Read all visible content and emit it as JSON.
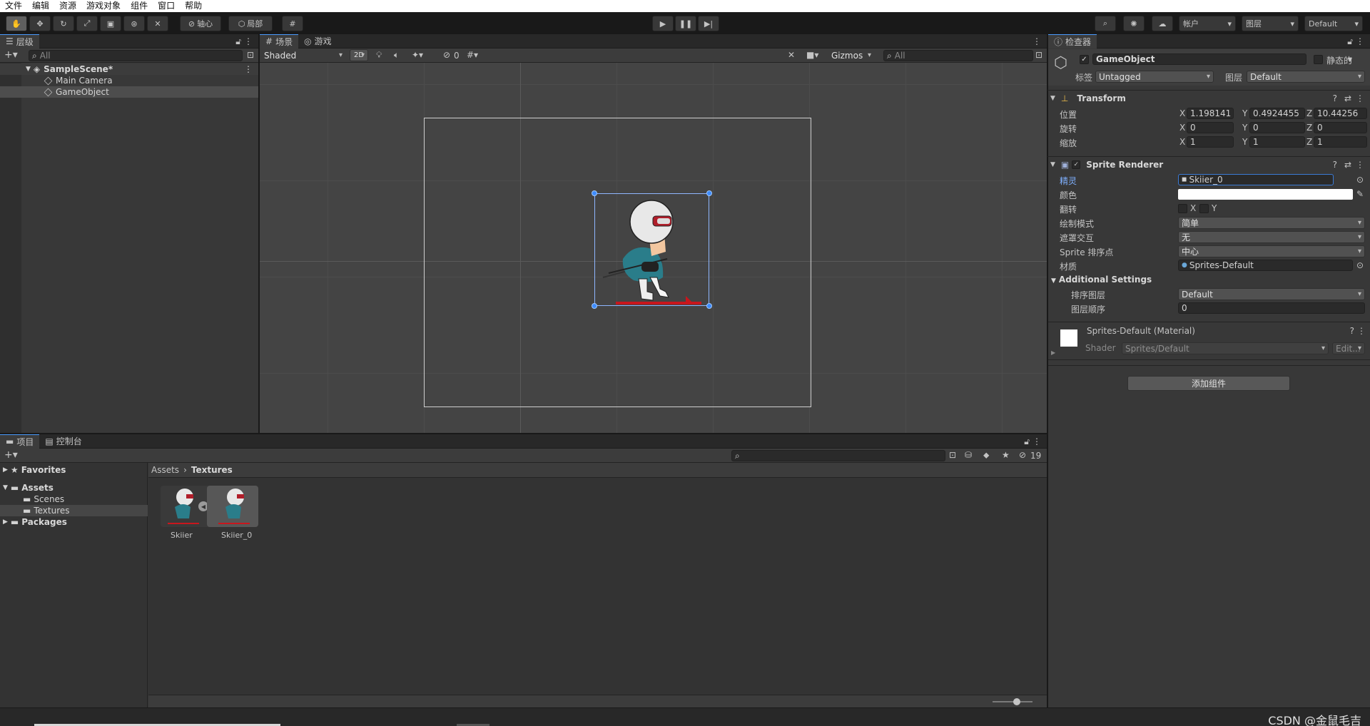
{
  "menu": [
    "文件",
    "编辑",
    "资源",
    "游戏对象",
    "组件",
    "窗口",
    "帮助"
  ],
  "toolbar": {
    "pivot": "轴心",
    "local": "局部",
    "account": "帐户",
    "layers": "图层",
    "layout": "Default"
  },
  "hierarchy": {
    "tab": "层级",
    "search_placeholder": "All",
    "scene": "SampleScene*",
    "items": [
      "Main Camera",
      "GameObject"
    ]
  },
  "scene_view": {
    "tabs": [
      "场景",
      "游戏"
    ],
    "shading": "Shaded",
    "mode2d": "2D",
    "hidden_count": "0",
    "gizmos": "Gizmos",
    "search_placeholder": "All"
  },
  "project": {
    "tabs": [
      "项目",
      "控制台"
    ],
    "hidden_count": "19",
    "tree": {
      "favorites": "Favorites",
      "assets": "Assets",
      "children": [
        "Scenes",
        "Textures"
      ],
      "packages": "Packages"
    },
    "breadcrumb": [
      "Assets",
      "Textures"
    ],
    "assets": [
      "Skiier",
      "Skiier_0"
    ],
    "slider_value": 0.6
  },
  "inspector": {
    "tab": "检查器",
    "object_name": "GameObject",
    "static_label": "静态的",
    "tag_label": "标签",
    "tag_value": "Untagged",
    "layer_label": "图层",
    "layer_value": "Default",
    "transform": {
      "title": "Transform",
      "rows": [
        {
          "label": "位置",
          "x": "1.198141",
          "y": "0.4924455",
          "z": "10.44256"
        },
        {
          "label": "旋转",
          "x": "0",
          "y": "0",
          "z": "0"
        },
        {
          "label": "缩放",
          "x": "1",
          "y": "1",
          "z": "1"
        }
      ]
    },
    "sprite_renderer": {
      "title": "Sprite Renderer",
      "sprite_label": "精灵",
      "sprite_value": "Skiier_0",
      "color_label": "颜色",
      "flip_label": "翻转",
      "flip_x": "X",
      "flip_y": "Y",
      "draw_mode_label": "绘制模式",
      "draw_mode_value": "简单",
      "mask_label": "遮罩交互",
      "mask_value": "无",
      "sort_point_label": "Sprite 排序点",
      "sort_point_value": "中心",
      "material_label": "材质",
      "material_value": "Sprites-Default",
      "additional": "Additional Settings",
      "sorting_layer_label": "排序图层",
      "sorting_layer_value": "Default",
      "order_label": "图层顺序",
      "order_value": "0"
    },
    "material": {
      "title": "Sprites-Default (Material)",
      "shader_label": "Shader",
      "shader_value": "Sprites/Default",
      "edit": "Edit..."
    },
    "add_component": "添加组件"
  },
  "watermark": "CSDN @金鼠毛吉"
}
